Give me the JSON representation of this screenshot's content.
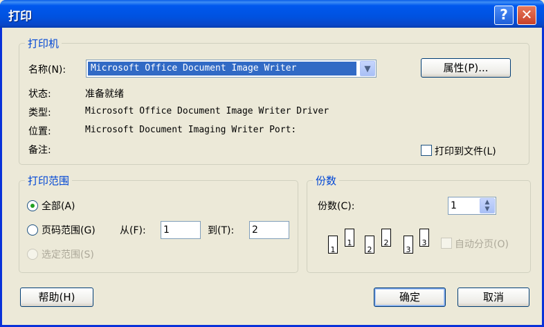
{
  "window": {
    "title": "打印",
    "help_glyph": "?",
    "close_glyph": "✕"
  },
  "printer": {
    "group_title": "打印机",
    "name_label": "名称(N):",
    "name_value": "Microsoft Office Document Image Writer",
    "properties_button": "属性(P)...",
    "status_label": "状态:",
    "status_value": "准备就绪",
    "type_label": "类型:",
    "type_value": "Microsoft Office Document Image Writer Driver",
    "location_label": "位置:",
    "location_value": "Microsoft Document Imaging Writer Port:",
    "comment_label": "备注:",
    "print_to_file_label": "打印到文件(L)"
  },
  "range": {
    "group_title": "打印范围",
    "all_label": "全部(A)",
    "pages_label": "页码范围(G)",
    "from_label": "从(F):",
    "from_value": "1",
    "to_label": "到(T):",
    "to_value": "2",
    "selection_label": "选定范围(S)"
  },
  "copies": {
    "group_title": "份数",
    "count_label": "份数(C):",
    "count_value": "1",
    "collate_label": "自动分页(O)",
    "collate_pages": [
      "1",
      "1",
      "2",
      "2",
      "3",
      "3"
    ]
  },
  "buttons": {
    "help": "帮助(H)",
    "ok": "确定",
    "cancel": "取消"
  },
  "icons": {
    "dropdown": "▼",
    "spin_up": "▲",
    "spin_down": "▼"
  }
}
